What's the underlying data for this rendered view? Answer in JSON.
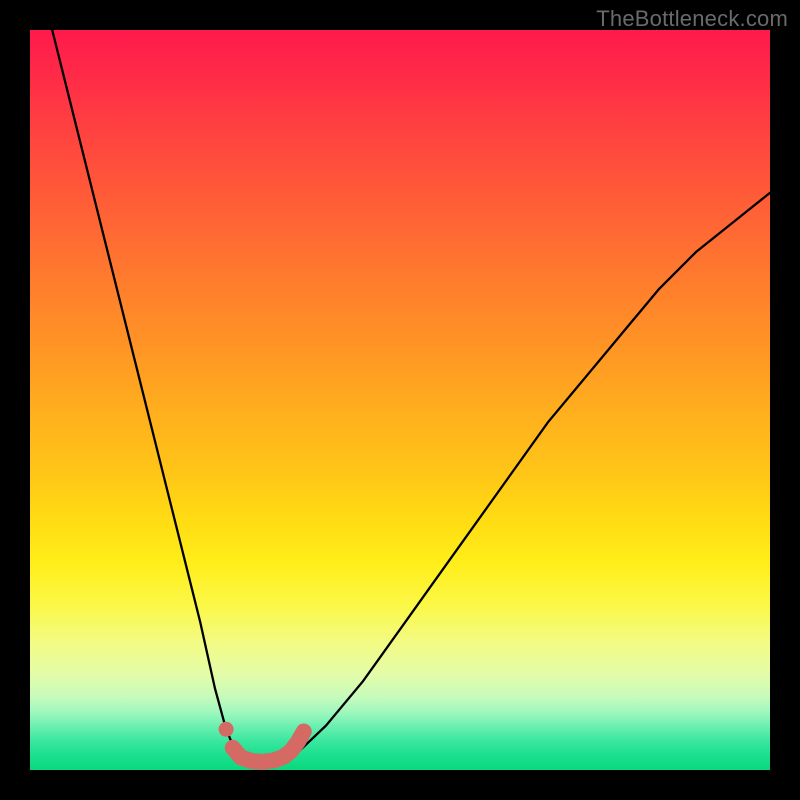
{
  "watermark": "TheBottleneck.com",
  "colors": {
    "page_bg": "#000000",
    "gradient_top": "#ff1a4c",
    "gradient_bottom": "#09d97f",
    "curve": "#000000",
    "marker": "#d46a63"
  },
  "chart_data": {
    "type": "line",
    "title": "",
    "xlabel": "",
    "ylabel": "",
    "xlim": [
      0,
      100
    ],
    "ylim": [
      0,
      100
    ],
    "grid": false,
    "legend": false,
    "note": "Values are read off from curve pixels against a 0–100 normalized axis; the vertical axis here represents bottleneck % (0 at bottom/green, 100 at top/red).",
    "series": [
      {
        "name": "left-branch",
        "x": [
          3,
          5,
          7,
          9,
          11,
          13,
          15,
          17,
          19,
          21,
          23,
          25,
          26.5,
          28
        ],
        "y": [
          100,
          92,
          84,
          76,
          68,
          60,
          52,
          44,
          36,
          28,
          20,
          11,
          5.5,
          2
        ]
      },
      {
        "name": "trough",
        "x": [
          28,
          29,
          30,
          31,
          32,
          33,
          34,
          35,
          36
        ],
        "y": [
          2,
          1.3,
          1,
          0.9,
          0.9,
          1,
          1.2,
          1.6,
          2.2
        ]
      },
      {
        "name": "right-branch",
        "x": [
          36,
          40,
          45,
          50,
          55,
          60,
          65,
          70,
          75,
          80,
          85,
          90,
          95,
          100
        ],
        "y": [
          2.2,
          6,
          12,
          19,
          26,
          33,
          40,
          47,
          53,
          59,
          65,
          70,
          74,
          78
        ]
      }
    ],
    "markers": {
      "name": "trough-markers",
      "note": "Coral rounded markers highlighting the optimal (zero-bottleneck) region",
      "points": [
        {
          "x": 26.5,
          "y": 5.5
        },
        {
          "x": 27.4,
          "y": 3.0
        },
        {
          "x": 28.5,
          "y": 1.7
        },
        {
          "x": 30.0,
          "y": 1.2
        },
        {
          "x": 31.5,
          "y": 1.1
        },
        {
          "x": 33.0,
          "y": 1.3
        },
        {
          "x": 34.3,
          "y": 1.8
        },
        {
          "x": 35.3,
          "y": 2.6
        },
        {
          "x": 36.2,
          "y": 3.8
        },
        {
          "x": 37.0,
          "y": 5.2
        }
      ]
    }
  }
}
